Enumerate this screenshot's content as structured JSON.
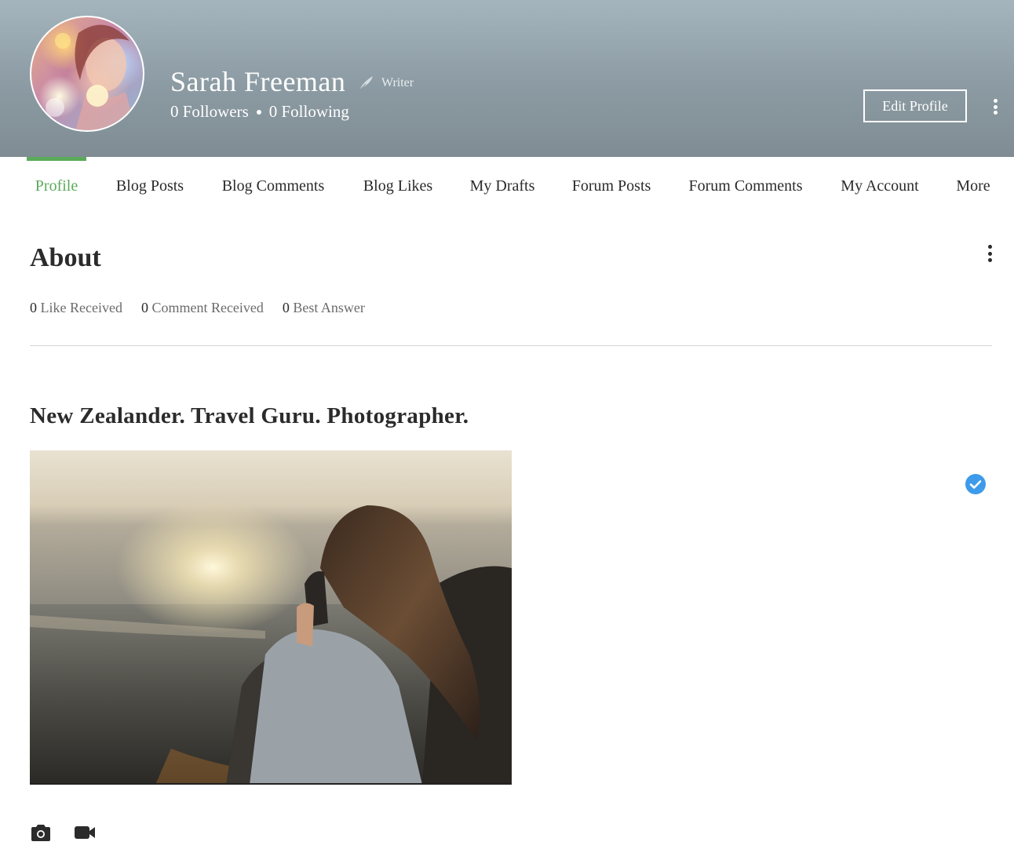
{
  "header": {
    "name": "Sarah Freeman",
    "role": "Writer",
    "followers_count": "0",
    "followers_label": "Followers",
    "following_count": "0",
    "following_label": "Following",
    "edit_profile_label": "Edit Profile",
    "role_icon": "quill-icon",
    "more_icon": "more-vertical-icon"
  },
  "tabs": [
    {
      "label": "Profile",
      "active": true
    },
    {
      "label": "Blog Posts"
    },
    {
      "label": "Blog Comments"
    },
    {
      "label": "Blog Likes"
    },
    {
      "label": "My Drafts"
    },
    {
      "label": "Forum Posts"
    },
    {
      "label": "Forum Comments"
    },
    {
      "label": "My Account"
    },
    {
      "label": "More"
    }
  ],
  "about": {
    "title": "About",
    "stats": [
      {
        "count": "0",
        "label": "Like Received"
      },
      {
        "count": "0",
        "label": "Comment Received"
      },
      {
        "count": "0",
        "label": "Best Answer"
      }
    ],
    "bio_heading": "New Zealander. Travel Guru. Photographer.",
    "verified_icon": "verified-check-icon",
    "media_icons": [
      "camera-icon",
      "video-camera-icon"
    ]
  },
  "colors": {
    "accent": "#5aab5a",
    "header_top": "#a5b5bd",
    "header_bottom": "#7f8c93",
    "verified": "#3d9be9"
  }
}
